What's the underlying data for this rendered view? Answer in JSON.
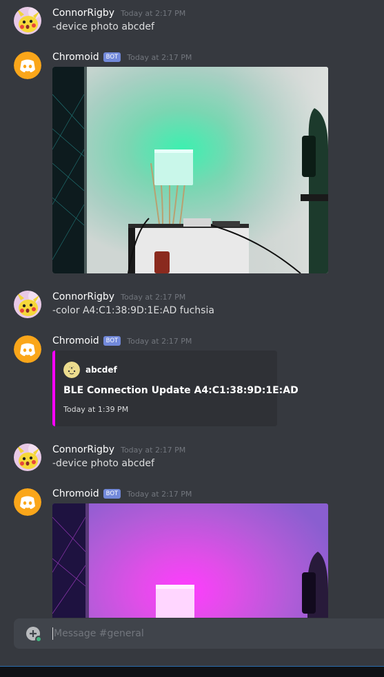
{
  "messages": [
    {
      "author": "ConnorRigby",
      "is_bot": false,
      "timestamp": "Today at 2:17 PM",
      "text": "-device photo abcdef",
      "avatar_icon": "pikachu-avatar-icon"
    },
    {
      "author": "Chromoid",
      "is_bot": true,
      "bot_tag": "BOT",
      "timestamp": "Today at 2:17 PM",
      "attachment": "photo of lamp lit green",
      "avatar_icon": "discord-logo-icon"
    },
    {
      "author": "ConnorRigby",
      "is_bot": false,
      "timestamp": "Today at 2:17 PM",
      "text": "-color A4:C1:38:9D:1E:AD fuchsia",
      "avatar_icon": "pikachu-avatar-icon"
    },
    {
      "author": "Chromoid",
      "is_bot": true,
      "bot_tag": "BOT",
      "timestamp": "Today at 2:17 PM",
      "avatar_icon": "discord-logo-icon",
      "embed": {
        "author": "abcdef",
        "title": "BLE Connection Update A4:C1:38:9D:1E:AD",
        "footer": "Today at 1:39 PM",
        "accent": "#ff00ff"
      }
    },
    {
      "author": "ConnorRigby",
      "is_bot": false,
      "timestamp": "Today at 2:17 PM",
      "text": "-device photo abcdef",
      "avatar_icon": "pikachu-avatar-icon"
    },
    {
      "author": "Chromoid",
      "is_bot": true,
      "bot_tag": "BOT",
      "timestamp": "Today at 2:17 PM",
      "attachment": "photo of lamp lit fuchsia",
      "avatar_icon": "discord-logo-icon"
    }
  ],
  "composer": {
    "placeholder": "Message #general",
    "add_icon": "plus-circle-icon"
  },
  "colors": {
    "background": "#36393f",
    "bot_tag": "#7289da",
    "embed_accent": "#ff00ff",
    "discord_orange": "#faa61a"
  }
}
